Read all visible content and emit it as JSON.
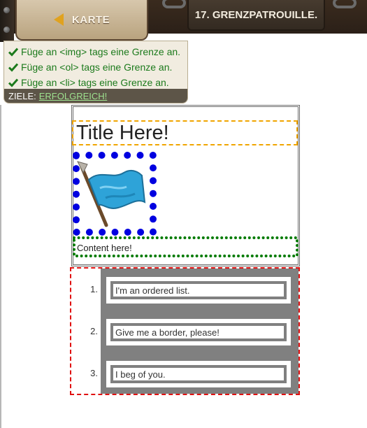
{
  "header": {
    "map_button_label": "KARTE",
    "level_title": "17. GRENZPATROUILLE."
  },
  "goals": {
    "items": [
      "Füge an <img> tags eine Grenze an.",
      "Füge an <ol> tags eine Grenze an.",
      "Füge an <li> tags eine Grenze an."
    ],
    "footer_label": "ZIELE:",
    "status": "ERFOLGREICH!"
  },
  "preview": {
    "title": "Title Here!",
    "image_icon": "blue-flag-icon",
    "content": "Content here!",
    "list": [
      {
        "number": "1.",
        "text": "I'm an ordered list."
      },
      {
        "number": "2.",
        "text": "Give me a border, please!"
      },
      {
        "number": "3.",
        "text": "I beg of you."
      }
    ]
  },
  "colors": {
    "success_green": "#1c7a1c",
    "title_border": "#f0a500",
    "img_border": "#0000e0",
    "content_border": "#007a00",
    "list_border": "#e01010",
    "ol_background": "#808080"
  }
}
